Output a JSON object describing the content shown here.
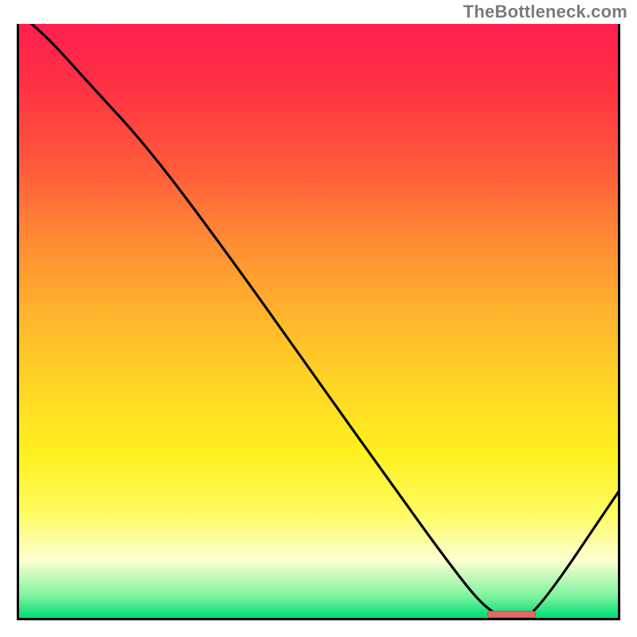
{
  "attribution": "TheBottleneck.com",
  "chart_data": {
    "type": "line",
    "title": "",
    "xlabel": "",
    "ylabel": "",
    "xlim": [
      0,
      100
    ],
    "ylim": [
      0,
      100
    ],
    "series": [
      {
        "name": "bottleneck-curve",
        "x": [
          0,
          4,
          12,
          22,
          36,
          50,
          62,
          72,
          78,
          82.5,
          86,
          100
        ],
        "values": [
          102,
          99,
          90,
          79,
          60,
          40,
          23,
          9,
          1.5,
          0,
          1,
          22
        ]
      }
    ],
    "marker": {
      "x_start": 78,
      "x_end": 86,
      "y": 0
    },
    "colors": {
      "gradient_top": "#ff1f4e",
      "gradient_mid": "#ffd426",
      "gradient_bottom": "#00d973",
      "curve": "#000000",
      "marker": "#e36a63"
    }
  }
}
